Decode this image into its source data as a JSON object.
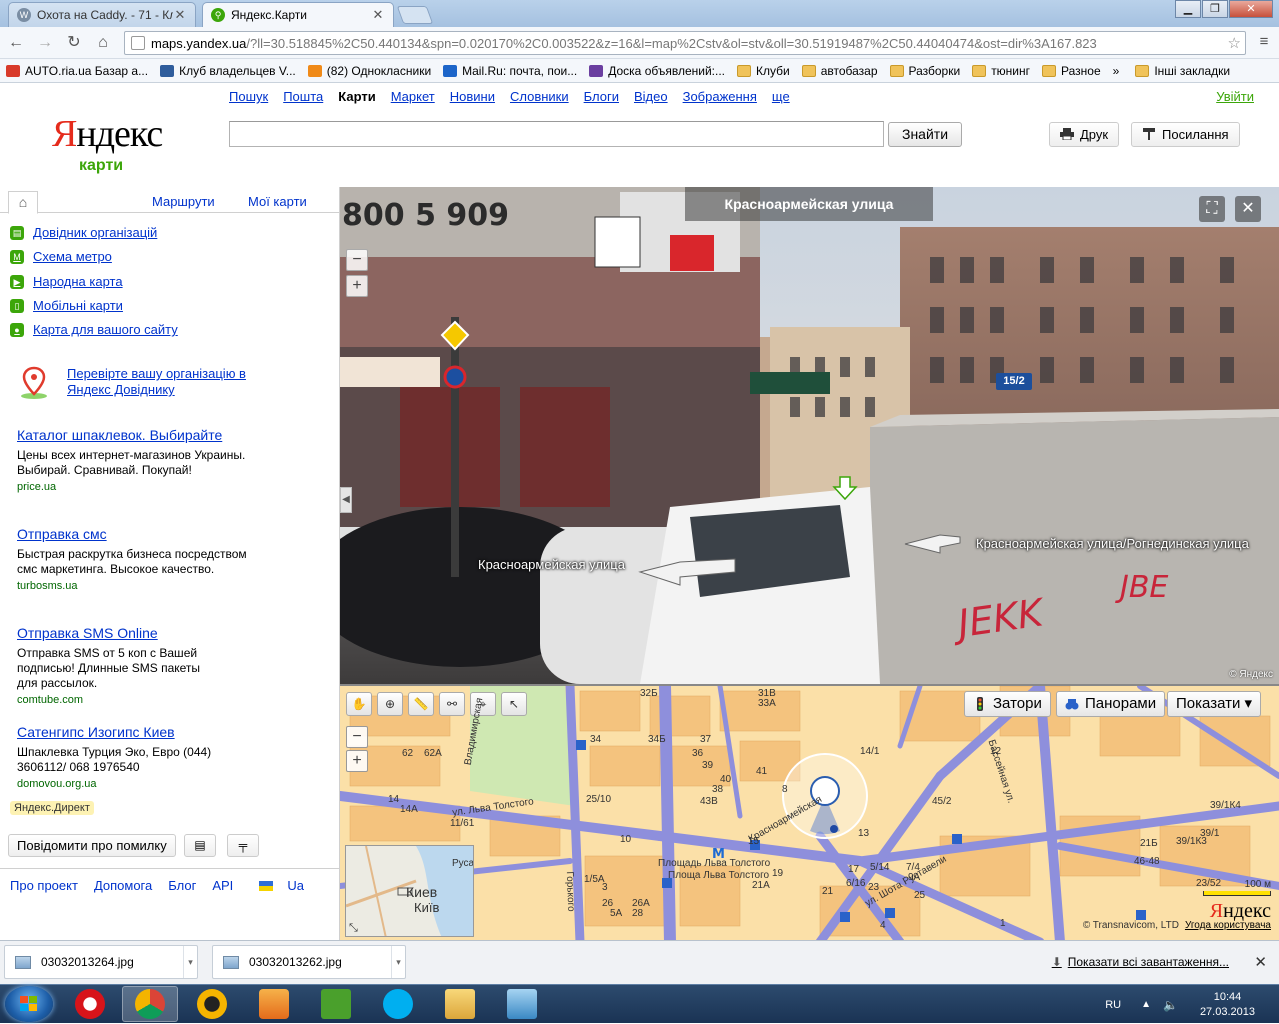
{
  "browser": {
    "tabs": [
      {
        "title": "Охота на Caddy. - 71 - Кл",
        "active": false
      },
      {
        "title": "Яндекс.Карти",
        "active": true
      }
    ],
    "url_host": "maps.yandex.ua",
    "url_rest": "/?ll=30.518845%2C50.440134&spn=0.020170%2C0.003522&z=16&l=map%2Cstv&ol=stv&oll=30.51919487%2C50.44040474&ost=dir%3A167.823",
    "bookmarks": [
      {
        "label": "AUTO.ria.ua Базар а...",
        "color": "#d83a2a",
        "folder": false
      },
      {
        "label": "Клуб владельцев V...",
        "color": "#2f5d9c",
        "folder": false
      },
      {
        "label": "(82) Однокласники",
        "color": "#f08a18",
        "folder": false
      },
      {
        "label": "Mail.Ru: почта, пои...",
        "color": "#1c65c9",
        "folder": false
      },
      {
        "label": "Доска объявлений:...",
        "color": "#6b3fa0",
        "folder": false
      },
      {
        "label": "Клуби",
        "color": "#f0c35a",
        "folder": true
      },
      {
        "label": "автобазар",
        "color": "#f0c35a",
        "folder": true
      },
      {
        "label": "Разборки",
        "color": "#f0c35a",
        "folder": true
      },
      {
        "label": "тюнинг",
        "color": "#f0c35a",
        "folder": true
      },
      {
        "label": "Разное",
        "color": "#f0c35a",
        "folder": true
      }
    ],
    "bookmarks_more": "»",
    "other_bookmarks": "Інші закладки"
  },
  "header": {
    "logo_first": "Я",
    "logo_rest": "ндекс",
    "logo_sub": "карти",
    "services": [
      "Пошук",
      "Пошта",
      "Карти",
      "Маркет",
      "Новини",
      "Словники",
      "Блоги",
      "Відео",
      "Зображення",
      "ще"
    ],
    "current_service": "Карти",
    "login": "Увійти",
    "search_value": "",
    "find_button": "Знайти",
    "print_button": "Друк",
    "link_button": "Посилання"
  },
  "sidebar": {
    "tabs": [
      "Маршрути",
      "Мої карти"
    ],
    "links": [
      {
        "label": "Довідник організацій",
        "icon": "directory-icon"
      },
      {
        "label": "Схема метро",
        "icon": "metro-icon"
      },
      {
        "label": "Народна карта",
        "icon": "people-map-icon"
      },
      {
        "label": "Мобільні карти",
        "icon": "mobile-icon"
      },
      {
        "label": "Карта для вашого сайту",
        "icon": "site-map-icon"
      }
    ],
    "check_org": "Перевірте вашу організацію в Яндекс Довіднику",
    "ads": [
      {
        "title": "Каталог шпаклевок. Выбирайте",
        "body": "Цены всех интернет-магазинов Украины. Выбирай. Сравнивай. Покупай!",
        "url": "price.ua"
      },
      {
        "title": "Отправка смс",
        "body": "Быстрая раскрутка бизнеса посредством смс маркетинга. Высокое качество.",
        "url": "turbosms.ua"
      },
      {
        "title": "Отправка SMS Online",
        "body": "Отправка SMS от 5 коп с Вашей подписью! Длинные SMS пакеты для рассылок.",
        "url": "comtube.com"
      },
      {
        "title": "Сатенгипс Изогипс Киев",
        "body": "Шпаклевка Турция Эко, Евро (044) 3606112/ 068 1976540",
        "url": "domovou.org.ua"
      }
    ],
    "direct_label": "Яндекс.Директ",
    "report_button": "Повідомити про помилку",
    "footer": [
      "Про проект",
      "Допомога",
      "Блог",
      "API",
      "Ua"
    ]
  },
  "panorama": {
    "title": "Красноармейская улица",
    "label_left": "Красноармейская улица",
    "label_right": "Красноармейская улица/Рогнединская улица",
    "house_number": "15/2",
    "copyright": "© Яндекс",
    "billboard": "800 5 909"
  },
  "map": {
    "buttons": [
      "Затори",
      "Панорами",
      "Показати ▾"
    ],
    "minimap_city_ru": "Киев",
    "minimap_city_ua": "Київ",
    "minimap_label": "Руса",
    "streets": [
      "ул. Льва Толстого",
      "Красноармейская",
      "Площадь Льва Толстого",
      "Площа Льва Толстого",
      "ул. Шота Руставели",
      "Бассейная ул.",
      "Горького",
      "Владимирская"
    ],
    "house_numbers": [
      "32Б",
      "31В",
      "33А",
      "62",
      "62А",
      "34",
      "34Б",
      "37",
      "36",
      "39",
      "38",
      "40",
      "41",
      "43В",
      "45/2",
      "14/1",
      "12",
      "8",
      "11/61",
      "25/10",
      "10",
      "13",
      "15",
      "19",
      "21",
      "23",
      "25",
      "17",
      "5/14",
      "9А",
      "7/4",
      "6/16",
      "21А",
      "26",
      "26А",
      "28",
      "1/5А",
      "3",
      "5А",
      "1",
      "4",
      "39/1",
      "39/1К3",
      "21Б",
      "46-48",
      "23/52",
      "39/1К4",
      "14",
      "14А"
    ],
    "scale": "100 м",
    "logo_first": "Я",
    "logo_rest": "ндекс",
    "copyright": "© Transnavicom, LTD",
    "terms": "Угода користувача"
  },
  "downloads": {
    "files": [
      "03032013264.jpg",
      "03032013262.jpg"
    ],
    "show_all": "Показати всі завантаження..."
  },
  "taskbar": {
    "lang": "RU",
    "time": "10:44",
    "date": "27.03.2013"
  }
}
